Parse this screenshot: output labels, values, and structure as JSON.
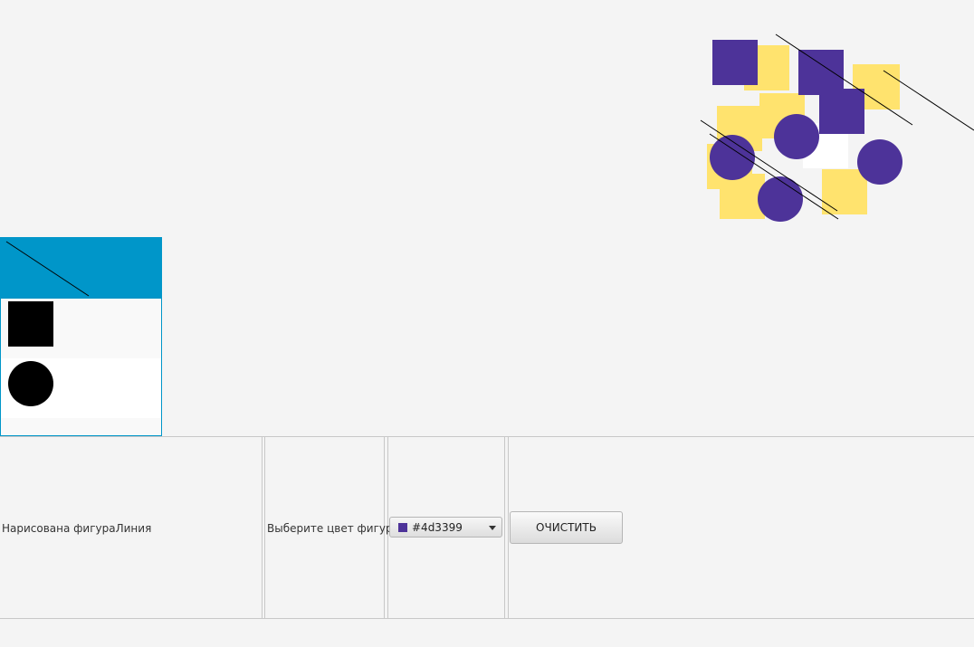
{
  "shape_list": {
    "items": [
      {
        "name": "line-icon",
        "selected": true
      },
      {
        "name": "square-icon",
        "selected": false
      },
      {
        "name": "circle-icon",
        "selected": false
      }
    ]
  },
  "status": {
    "text": "Нарисована фигураЛиния"
  },
  "color_picker": {
    "label": "Выберите цвет фигуры:",
    "value": "#4d3399",
    "swatch_color": "#4d3399"
  },
  "clear_button": {
    "label": "ОЧИСТИТЬ"
  },
  "colors": {
    "accent": "#0096c9",
    "shape_purple": "#4d3399",
    "shape_yellow": "#ffe36e"
  }
}
